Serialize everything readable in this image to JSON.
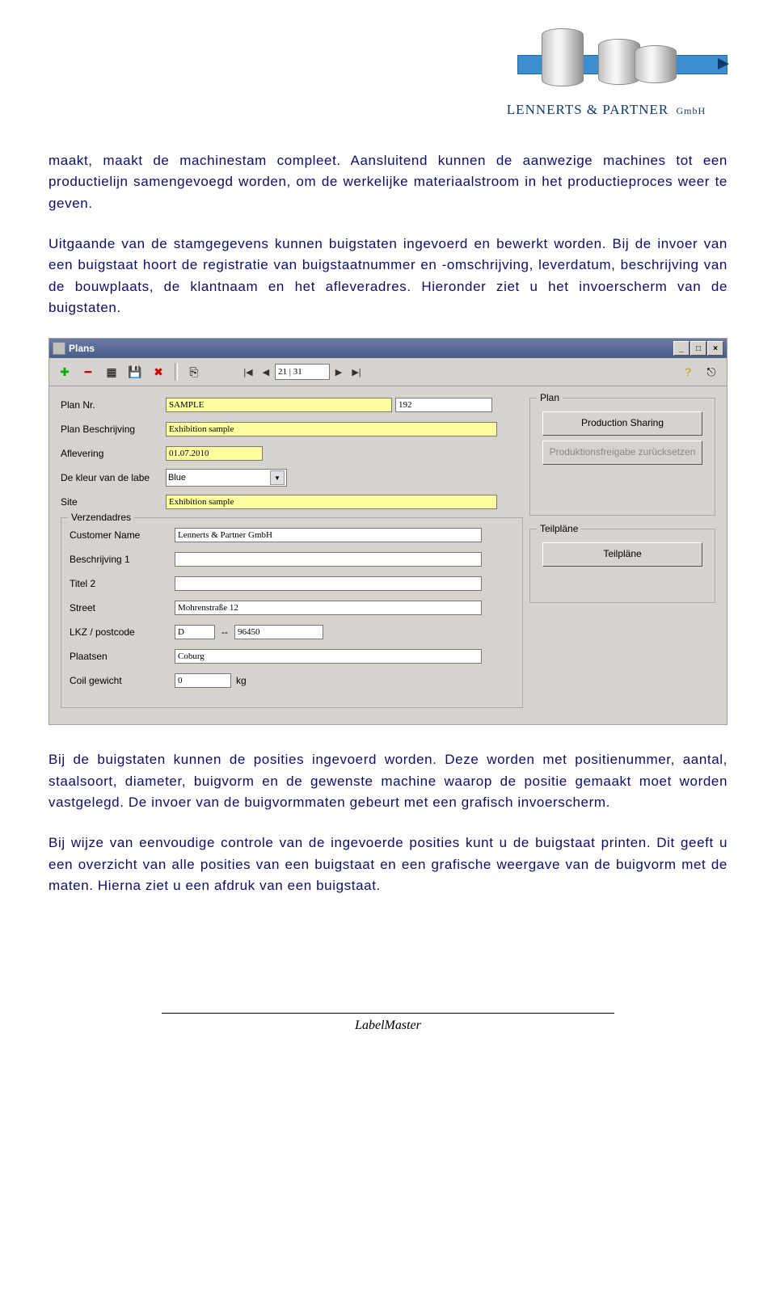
{
  "logo": {
    "company_line": "LENNERTS & PARTNER",
    "company_suffix": "GmbH"
  },
  "paragraphs": {
    "p1": "maakt, maakt de machinestam compleet. Aansluitend kunnen de aanwezige machines tot een productielijn samengevoegd worden, om de werkelijke materiaalstroom in het productieproces weer te geven.",
    "p2": "Uitgaande van de stamgegevens kunnen buigstaten ingevoerd en bewerkt worden. Bij de invoer van een buigstaat hoort de registratie van buigstaatnummer en -omschrijving, leverdatum, beschrijving van de bouwplaats, de klantnaam en het afleveradres. Hieronder ziet u het invoerscherm van de buigstaten.",
    "p3": "Bij de buigstaten kunnen de posities ingevoerd worden. Deze worden met positienummer, aantal, staalsoort, diameter, buigvorm en de gewenste machine waarop de positie gemaakt moet worden vastgelegd. De invoer van de buigvormmaten gebeurt met een grafisch invoerscherm.",
    "p4": "Bij wijze van eenvoudige controle van de ingevoerde posities kunt u de buigstaat printen. Dit geeft u een overzicht van alle posities van een buigstaat en een grafische weergave van de buigvorm met de maten. Hierna ziet u een afdruk van een buigstaat."
  },
  "window": {
    "title": "Plans",
    "record_position": "21 | 31"
  },
  "form": {
    "labels": {
      "plan_nr": "Plan Nr.",
      "plan_beschrijving": "Plan Beschrijving",
      "aflevering": "Aflevering",
      "kleur": "De kleur van de labe",
      "site": "Site",
      "verzendadres": "Verzendadres",
      "customer_name": "Customer Name",
      "beschrijving1": "Beschrijving 1",
      "titel2": "Titel 2",
      "street": "Street",
      "lkz_postcode": "LKZ / postcode",
      "plaatsen": "Plaatsen",
      "coil_gewicht": "Coil gewicht",
      "sep": "--",
      "kg": "kg"
    },
    "values": {
      "plan_nr": "SAMPLE",
      "plan_nr2": "192",
      "plan_beschrijving": "Exhibition sample",
      "aflevering": "01.07.2010",
      "kleur": "Blue",
      "site": "Exhibition sample",
      "customer_name": "Lennerts & Partner GmbH",
      "beschrijving1": "",
      "titel2": "",
      "street": "Mohrenstraße 12",
      "lkz": "D",
      "postcode": "96450",
      "plaatsen": "Coburg",
      "coil_gewicht": "0"
    },
    "groups": {
      "plan": "Plan",
      "teilplane_group": "Teilpläne"
    },
    "buttons": {
      "production_sharing": "Production Sharing",
      "prod_reset": "Produktionsfreigabe zurücksetzen",
      "teilplane": "Teilpläne"
    }
  },
  "footer": "LabelMaster"
}
